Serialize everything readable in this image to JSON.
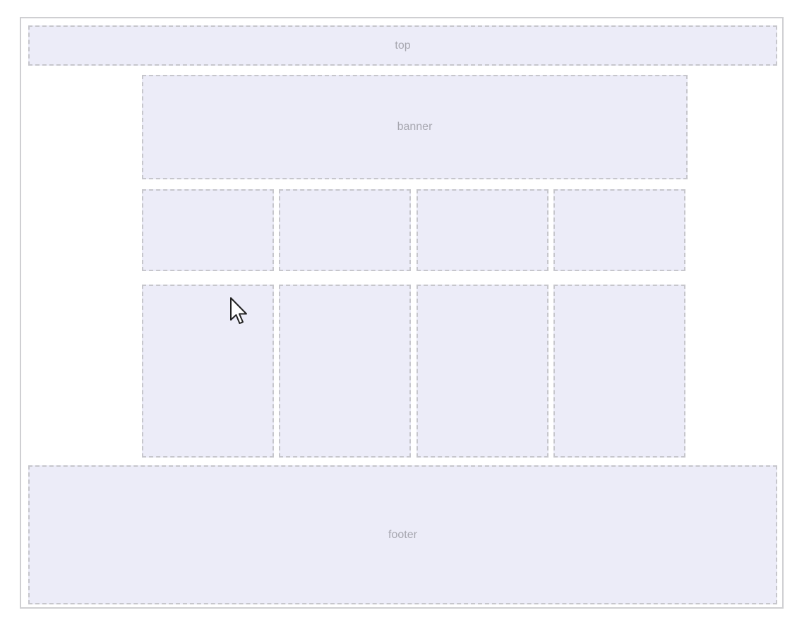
{
  "layout_diagram": {
    "top_label": "top",
    "banner_label": "banner",
    "footer_label": "footer",
    "row_small_cells": [
      "",
      "",
      "",
      ""
    ],
    "row_tall_cells": [
      "",
      "",
      "",
      ""
    ]
  },
  "colors": {
    "block_fill": "#ececf8",
    "block_border": "#c6c6cc",
    "frame_border": "#cfcfd2",
    "label_text": "#a7a7b0"
  },
  "cursor": {
    "icon": "mouse-pointer-icon"
  }
}
